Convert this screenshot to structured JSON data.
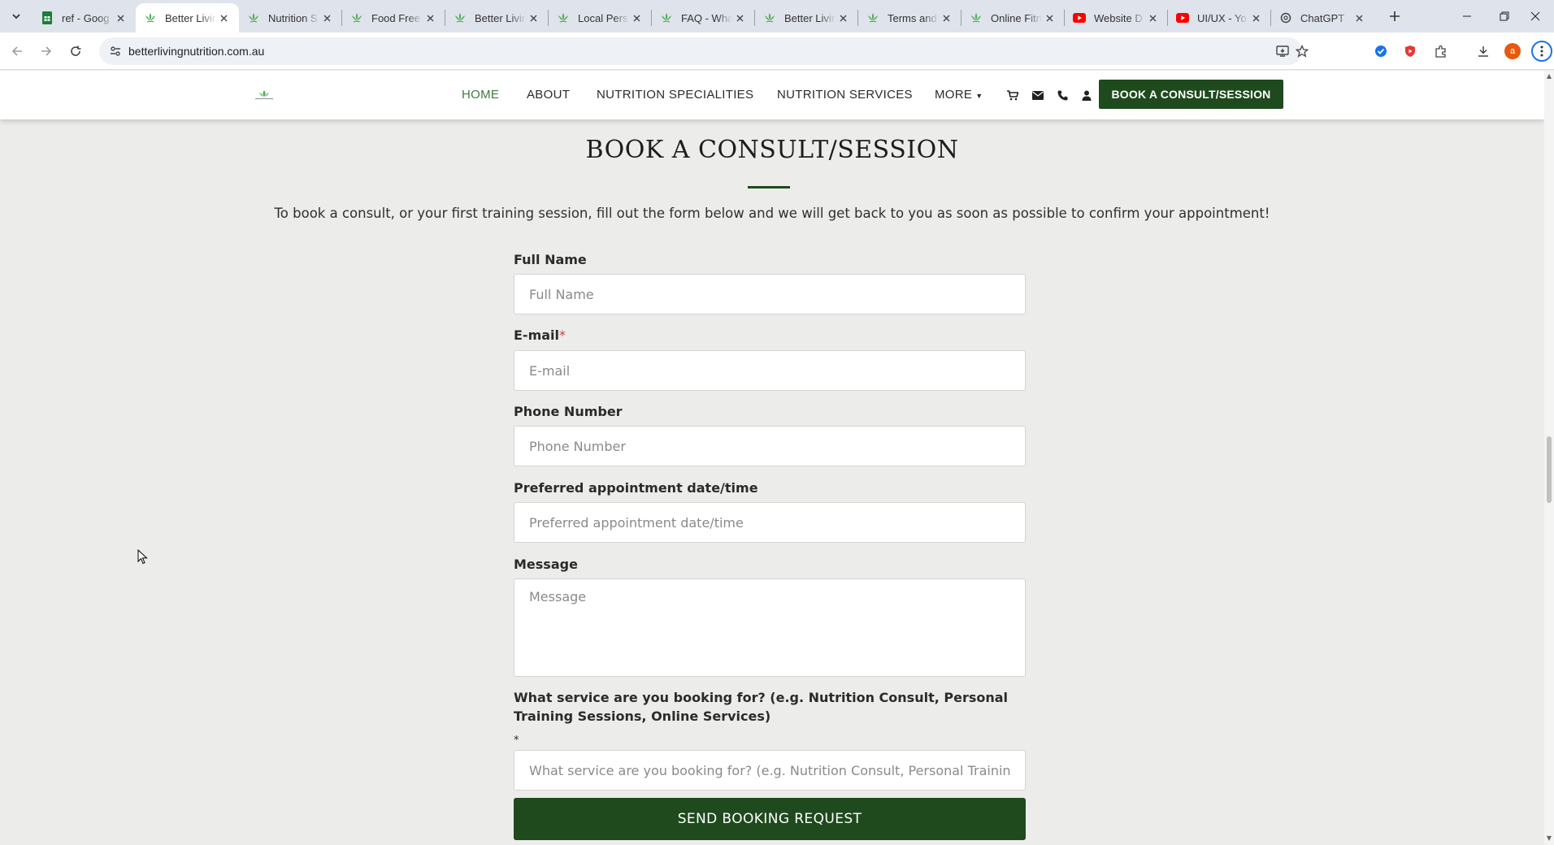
{
  "browser": {
    "tabs": [
      {
        "title": "ref - Goog",
        "icon": "sheets-icon",
        "color": "#188038"
      },
      {
        "title": "Better Livin",
        "icon": "leaf-icon",
        "color": "#4caf50",
        "active": true
      },
      {
        "title": "Nutrition S",
        "icon": "leaf-icon",
        "color": "#4caf50"
      },
      {
        "title": "Food Free",
        "icon": "leaf-icon",
        "color": "#4caf50"
      },
      {
        "title": "Better Livin",
        "icon": "leaf-icon",
        "color": "#4caf50"
      },
      {
        "title": "Local Pers",
        "icon": "leaf-icon",
        "color": "#4caf50"
      },
      {
        "title": "FAQ - Wha",
        "icon": "leaf-icon",
        "color": "#4caf50"
      },
      {
        "title": "Better Livin",
        "icon": "leaf-icon",
        "color": "#4caf50"
      },
      {
        "title": "Terms and",
        "icon": "leaf-icon",
        "color": "#4caf50"
      },
      {
        "title": "Online Fitn",
        "icon": "leaf-icon",
        "color": "#4caf50"
      },
      {
        "title": "Website D",
        "icon": "youtube-icon",
        "color": "#ff0000"
      },
      {
        "title": "UI/UX - Yo",
        "icon": "youtube-icon",
        "color": "#ff0000"
      },
      {
        "title": "ChatGPT",
        "icon": "chatgpt-icon",
        "color": "#444444"
      }
    ],
    "url": "betterlivingnutrition.com.au",
    "profile_initial": "a"
  },
  "header": {
    "nav": {
      "home": "HOME",
      "about": "ABOUT",
      "specialities": "NUTRITION SPECIALITIES",
      "services": "NUTRITION SERVICES",
      "more": "MORE"
    },
    "book_button": "BOOK A CONSULT/SESSION"
  },
  "page": {
    "title": "BOOK A CONSULT/SESSION",
    "intro": "To book a consult, or your first training session, fill out the form below and we will get back to you as soon as possible to confirm your appointment!"
  },
  "form": {
    "full_name": {
      "label": "Full Name",
      "placeholder": "Full Name"
    },
    "email": {
      "label": "E-mail",
      "required_mark": "*",
      "placeholder": "E-mail"
    },
    "phone": {
      "label": "Phone Number",
      "placeholder": "Phone Number"
    },
    "appointment": {
      "label": "Preferred appointment date/time",
      "placeholder": "Preferred appointment date/time"
    },
    "message": {
      "label": "Message",
      "placeholder": "Message"
    },
    "service": {
      "label": "What service are you booking for? (e.g. Nutrition Consult, Personal Training Sessions, Online Services)",
      "required_mark": "*",
      "placeholder": "What service are you booking for? (e.g. Nutrition Consult, Personal Training Sessions, Online Services)"
    },
    "submit": "SEND BOOKING REQUEST"
  },
  "colors": {
    "brand_green": "#1f4a1d",
    "nav_active": "#3f7a3c",
    "page_bg": "#ececea"
  }
}
